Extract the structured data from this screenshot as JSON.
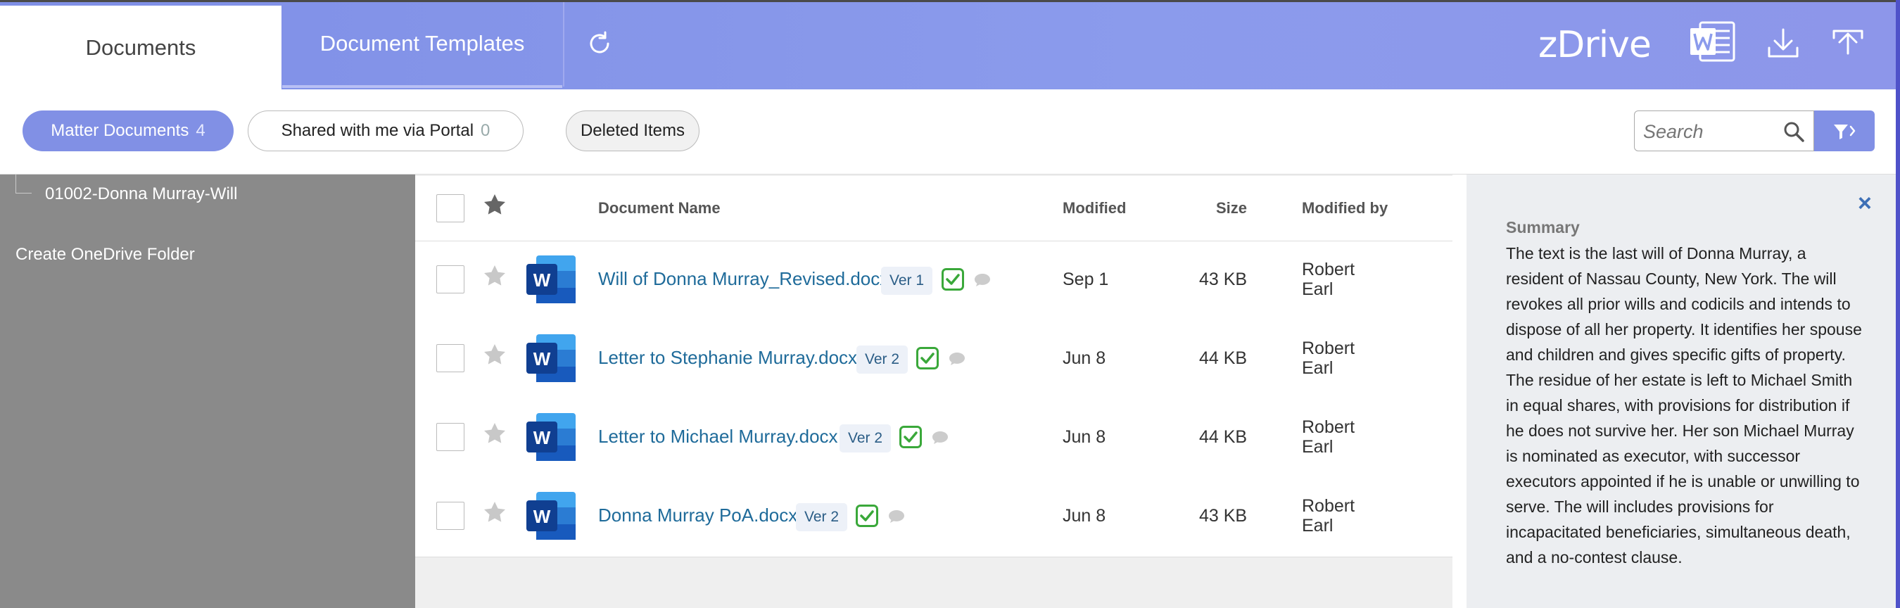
{
  "header": {
    "tabs": [
      {
        "label": "Documents",
        "active": true
      },
      {
        "label": "Document Templates",
        "active": false
      }
    ],
    "logo": "zDrive",
    "icons": [
      "refresh-icon",
      "word-icon",
      "download-icon",
      "upload-icon"
    ]
  },
  "filters": {
    "matter": {
      "label": "Matter Documents",
      "count": "4"
    },
    "shared": {
      "label": "Shared with me via Portal",
      "count": "0"
    },
    "deleted": {
      "label": "Deleted Items"
    },
    "search_placeholder": "Search"
  },
  "sidebar": {
    "tree_item": "01002-Donna Murray-Will",
    "create_folder": "Create OneDrive Folder"
  },
  "table": {
    "headers": {
      "name": "Document Name",
      "modified": "Modified",
      "size": "Size",
      "modified_by": "Modified by"
    },
    "rows": [
      {
        "name": "Will of Donna Murray_Revised.docx",
        "version": "Ver 1",
        "modified": "Sep 1",
        "size": "43 KB",
        "by1": "Robert",
        "by2": "Earl"
      },
      {
        "name": "Letter to Stephanie Murray.docx",
        "version": "Ver 2",
        "modified": "Jun 8",
        "size": "44 KB",
        "by1": "Robert",
        "by2": "Earl"
      },
      {
        "name": "Letter to Michael Murray.docx",
        "version": "Ver 2",
        "modified": "Jun 8",
        "size": "44 KB",
        "by1": "Robert",
        "by2": "Earl"
      },
      {
        "name": "Donna Murray PoA.docx",
        "version": "Ver 2",
        "modified": "Jun 8",
        "size": "43 KB",
        "by1": "Robert",
        "by2": "Earl"
      }
    ]
  },
  "summary": {
    "title": "Summary",
    "text": "The text is the last will of Donna Murray, a resident of Nassau County, New York. The will revokes all prior wills and codicils and intends to dispose of all her property. It identifies her spouse and children and gives specific gifts of property. The residue of her estate is left to Michael Smith in equal shares, with provisions for distribution if he does not survive her. Her son Michael Murray is nominated as executor, with successor executors appointed if he is unable or unwilling to serve. The will includes provisions for incapacitated beneficiaries, simultaneous death, and a no-contest clause.",
    "close": "×"
  },
  "colors": {
    "accent": "#8190e5",
    "link": "#1f6b9a",
    "check": "#3aa83a",
    "sidebar": "#8a8a8a"
  }
}
